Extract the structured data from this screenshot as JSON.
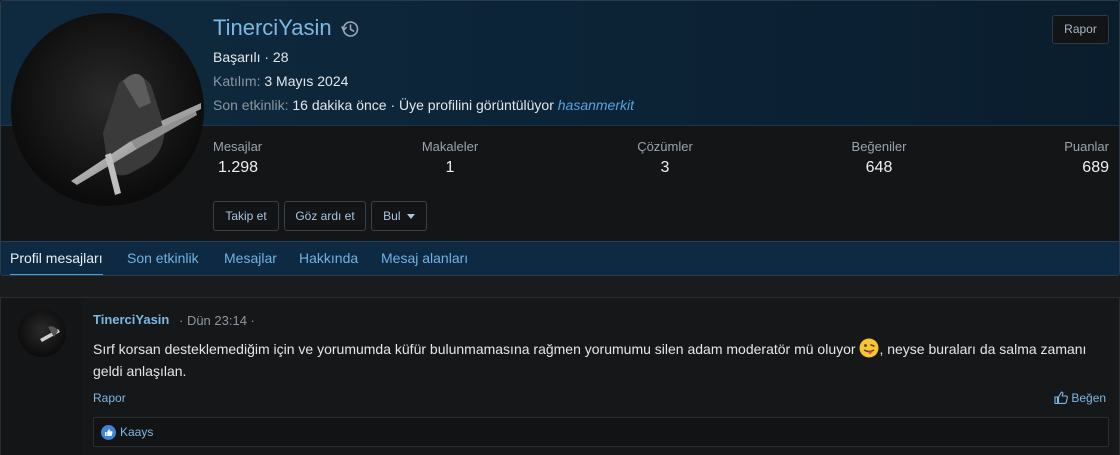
{
  "profile": {
    "username": "TinerciYasin",
    "rank": "Başarılı · 28",
    "joined_label": "Katılım:",
    "joined_value": "3 Mayıs 2024",
    "last_activity_label": "Son etkinlik:",
    "last_activity_value": "16 dakika önce · Üye profilini görüntülüyor",
    "last_activity_link": "hasanmerkit",
    "report_label": "Rapor"
  },
  "stats": [
    {
      "label": "Mesajlar",
      "value": "1.298"
    },
    {
      "label": "Makaleler",
      "value": "1"
    },
    {
      "label": "Çözümler",
      "value": "3"
    },
    {
      "label": "Beğeniler",
      "value": "648"
    },
    {
      "label": "Puanlar",
      "value": "689"
    }
  ],
  "actions": {
    "follow": "Takip et",
    "ignore": "Göz ardı et",
    "find": "Bul"
  },
  "tabs": [
    {
      "label": "Profil mesajları"
    },
    {
      "label": "Son etkinlik"
    },
    {
      "label": "Mesajlar"
    },
    {
      "label": "Hakkında"
    },
    {
      "label": "Mesaj alanları"
    }
  ],
  "message": {
    "author": "TinerciYasin",
    "time": "· Dün 23:14 ·",
    "text_before_emoji": "Sırf korsan desteklemediğim için ve yorumumda küfür bulunmamasına rağmen yorumumu silen adam moderatör mü oluyor ",
    "text_after_emoji": ", neyse buraları da salma zamanı geldi anlaşılan.",
    "report_label": "Rapor",
    "like_label": "Beğen",
    "reaction_users": "Kaays"
  },
  "colors": {
    "accent": "#7cb8e6",
    "header_bg": "#0f2a3f",
    "tab_bar": "#0d2a42"
  }
}
